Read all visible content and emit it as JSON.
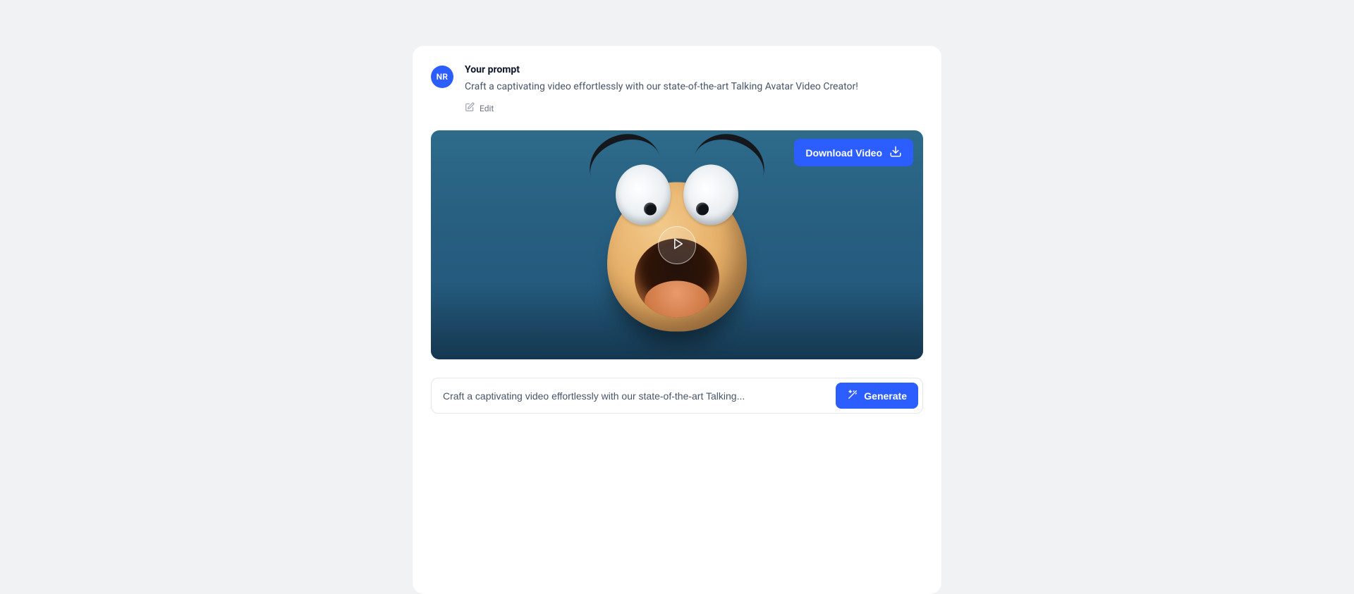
{
  "avatar": {
    "initials": "NR"
  },
  "prompt": {
    "title": "Your prompt",
    "text": "Craft a captivating video effortlessly with our state-of-the-art Talking Avatar Video Creator!",
    "edit_label": "Edit"
  },
  "video": {
    "download_label": "Download Video"
  },
  "input": {
    "value": "Craft a captivating video effortlessly with our state-of-the-art Talking...",
    "generate_label": "Generate"
  }
}
